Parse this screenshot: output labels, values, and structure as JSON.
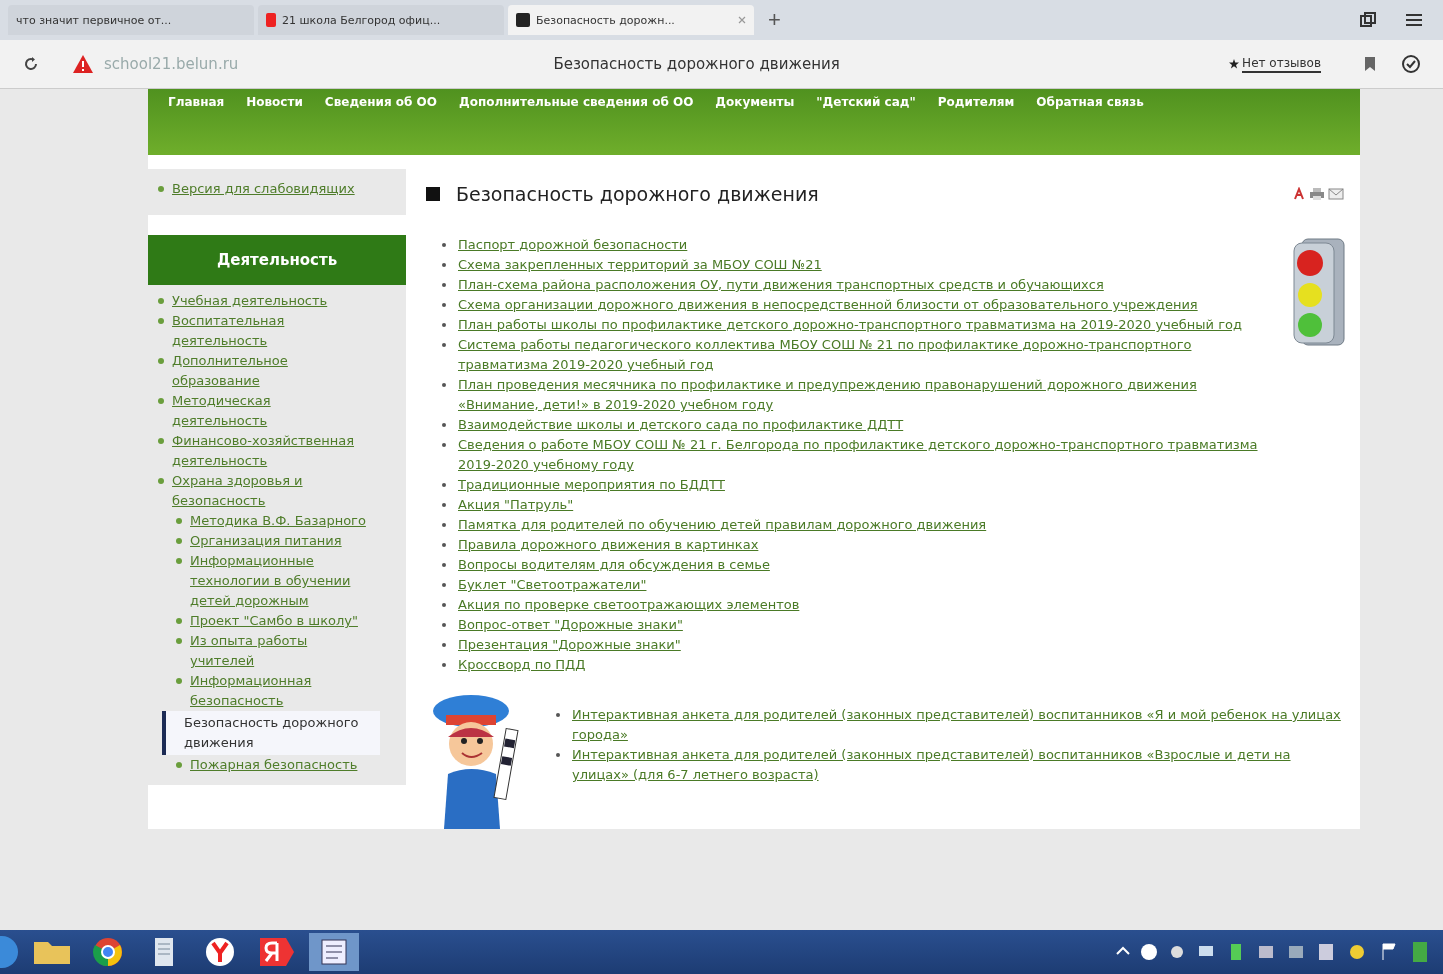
{
  "browser": {
    "tabs": [
      {
        "title": "что значит первичное от...",
        "selected": false
      },
      {
        "title": "21 школа Белгород офиц...",
        "selected": false
      },
      {
        "title": "Безопасность дорожн...",
        "selected": true
      }
    ],
    "new_tab": "+",
    "address": "school21.belun.ru",
    "page_title": "Безопасность дорожного движения",
    "reviews": "Нет отзывов"
  },
  "nav": [
    "Главная",
    "Новости",
    "Сведения об ОО",
    "Дополнительные сведения об ОО",
    "Документы",
    "\"Детский сад\"",
    "Родителям",
    "Обратная связь"
  ],
  "sidebar": {
    "top_link": "Версия для слабовидящих",
    "heading": "Деятельность",
    "items": [
      {
        "label": "Учебная деятельность",
        "selected": false
      },
      {
        "label": "Воспитательная деятельность",
        "selected": false
      },
      {
        "label": "Дополнительное образование",
        "selected": false
      },
      {
        "label": "Методическая деятельность",
        "selected": false
      },
      {
        "label": "Финансово-хозяйственная деятельность",
        "selected": false
      },
      {
        "label": "Охрана здоровья и безопасность",
        "selected": false,
        "children": [
          {
            "label": "Методика В.Ф. Базарного",
            "selected": false
          },
          {
            "label": "Организация питания",
            "selected": false
          },
          {
            "label": "Информационные технологии в обучении детей дорожным",
            "selected": false
          },
          {
            "label": "Проект \"Самбо в школу\"",
            "selected": false
          },
          {
            "label": "Из опыта работы учителей",
            "selected": false
          },
          {
            "label": "Информационная безопасность",
            "selected": false
          },
          {
            "label": "Безопасность дорожного движения",
            "selected": true
          },
          {
            "label": "Пожарная безопасность",
            "selected": false
          }
        ]
      }
    ]
  },
  "article": {
    "title": "Безопасность дорожного движения",
    "links": [
      "Паспорт дорожной безопасности",
      "Схема закрепленных территорий за МБОУ СОШ №21",
      "План-схема района расположения ОУ, пути движения транспортных средств и обучающихся",
      "Схема организации дорожного движения в непосредственной близости от образовательного учреждения",
      "План работы школы по профилактике детского дорожно-транспортного травматизма на 2019-2020 учебный год",
      "Система работы педагогического коллектива МБОУ СОШ № 21 по профилактике дорожно-транспортного травматизма 2019-2020 учебный год",
      "План проведения месячника по профилактике и предупреждению правонарушений дорожного движения «Внимание, дети!» в 2019-2020 учебном году",
      "Взаимодействие школы и детского сада по профилактике ДДТТ",
      "Сведения о работе МБОУ СОШ № 21 г. Белгорода по профилактике детского дорожно-транспортного травматизма 2019-2020 учебному году",
      "Традиционные мероприятия по БДДТТ",
      "Акция \"Патруль\"",
      "Памятка для родителей по обучению детей правилам дорожного движения",
      "Правила дорожного движения в картинках",
      "Вопросы водителям для обсуждения в семье",
      "Буклет \"Светоотражатели\"",
      "Акция по проверке светоотражающих элементов",
      "Вопрос-ответ \"Дорожные знаки\"",
      "Презентация \"Дорожные знаки\"",
      "Кроссворд по ПДД"
    ],
    "survey_links": [
      "Интерактивная анкета для родителей (законных представителей) воспитанников «Я и мой ребенок на улицах города»",
      "Интерактивная анкета для родителей (законных представителей) воспитанников «Взрослые и дети на улицах» (для 6-7 летнего возраста)"
    ]
  }
}
